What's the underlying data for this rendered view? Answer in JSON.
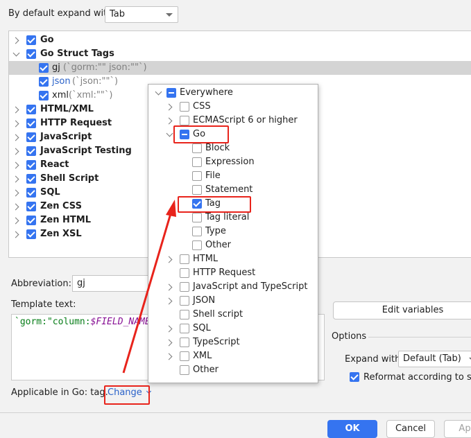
{
  "expand": {
    "label": "By default expand with",
    "value": "Tab"
  },
  "tree": [
    {
      "label": "Go",
      "bold": true,
      "expanded": false,
      "checked": true
    },
    {
      "label": "Go Struct Tags",
      "bold": true,
      "expanded": true,
      "checked": true
    },
    {
      "name": "gj",
      "desc": "(`gorm:\"\" json:\"\"`)",
      "selected": true,
      "checked": true
    },
    {
      "name": "json",
      "desc": "(`json:\"\"`)",
      "blue": true,
      "checked": true
    },
    {
      "name": "xml",
      "desc": "(`xml:\"\"`)",
      "checked": true
    },
    {
      "label": "HTML/XML",
      "bold": true,
      "checked": true
    },
    {
      "label": "HTTP Request",
      "bold": true,
      "checked": true
    },
    {
      "label": "JavaScript",
      "bold": true,
      "checked": true
    },
    {
      "label": "JavaScript Testing",
      "bold": true,
      "checked": true
    },
    {
      "label": "React",
      "bold": true,
      "checked": true
    },
    {
      "label": "Shell Script",
      "bold": true,
      "checked": true
    },
    {
      "label": "SQL",
      "bold": true,
      "checked": true
    },
    {
      "label": "Zen CSS",
      "bold": true,
      "checked": true
    },
    {
      "label": "Zen HTML",
      "bold": true,
      "checked": true
    },
    {
      "label": "Zen XSL",
      "bold": true,
      "checked": true
    }
  ],
  "abbreviation": {
    "label": "Abbreviation:",
    "value": "gj"
  },
  "template": {
    "label": "Template text:",
    "code_prefix": "`gorm:\"column:",
    "code_var": "$FIELD_NAME"
  },
  "edit_variables": "Edit variables",
  "options": {
    "title": "Options",
    "expand_label": "Expand with",
    "expand_value": "Default (Tab)",
    "reformat_label": "Reformat according to styl"
  },
  "applicable": {
    "label": "Applicable in Go: tag.",
    "change": "Change"
  },
  "buttons": {
    "ok": "OK",
    "cancel": "Cancel",
    "apply": "Ap"
  },
  "popup": {
    "items": [
      {
        "label": "Everywhere",
        "state": "mixed",
        "chev": "down",
        "level": 0
      },
      {
        "label": "CSS",
        "state": "off",
        "chev": "right",
        "level": 1
      },
      {
        "label": "ECMAScript 6 or higher",
        "state": "off",
        "chev": "right",
        "level": 1
      },
      {
        "label": "Go",
        "state": "mixed",
        "chev": "down",
        "level": 1
      },
      {
        "label": "Block",
        "state": "off",
        "level": 2
      },
      {
        "label": "Expression",
        "state": "off",
        "level": 2
      },
      {
        "label": "File",
        "state": "off",
        "level": 2
      },
      {
        "label": "Statement",
        "state": "off",
        "level": 2
      },
      {
        "label": "Tag",
        "state": "on",
        "level": 2
      },
      {
        "label": "Tag literal",
        "state": "off",
        "level": 2
      },
      {
        "label": "Type",
        "state": "off",
        "level": 2
      },
      {
        "label": "Other",
        "state": "off",
        "level": 2
      },
      {
        "label": "HTML",
        "state": "off",
        "chev": "right",
        "level": 1
      },
      {
        "label": "HTTP Request",
        "state": "off",
        "level": 1
      },
      {
        "label": "JavaScript and TypeScript",
        "state": "off",
        "chev": "right",
        "level": 1
      },
      {
        "label": "JSON",
        "state": "off",
        "chev": "right",
        "level": 1
      },
      {
        "label": "Shell script",
        "state": "off",
        "level": 1
      },
      {
        "label": "SQL",
        "state": "off",
        "chev": "right",
        "level": 1
      },
      {
        "label": "TypeScript",
        "state": "off",
        "chev": "right",
        "level": 1
      },
      {
        "label": "XML",
        "state": "off",
        "chev": "right",
        "level": 1
      },
      {
        "label": "Other",
        "state": "off",
        "level": 1
      }
    ]
  },
  "colors": {
    "accent": "#3574f0",
    "annotation": "#e8231b",
    "selection": "#d4d4d4"
  }
}
